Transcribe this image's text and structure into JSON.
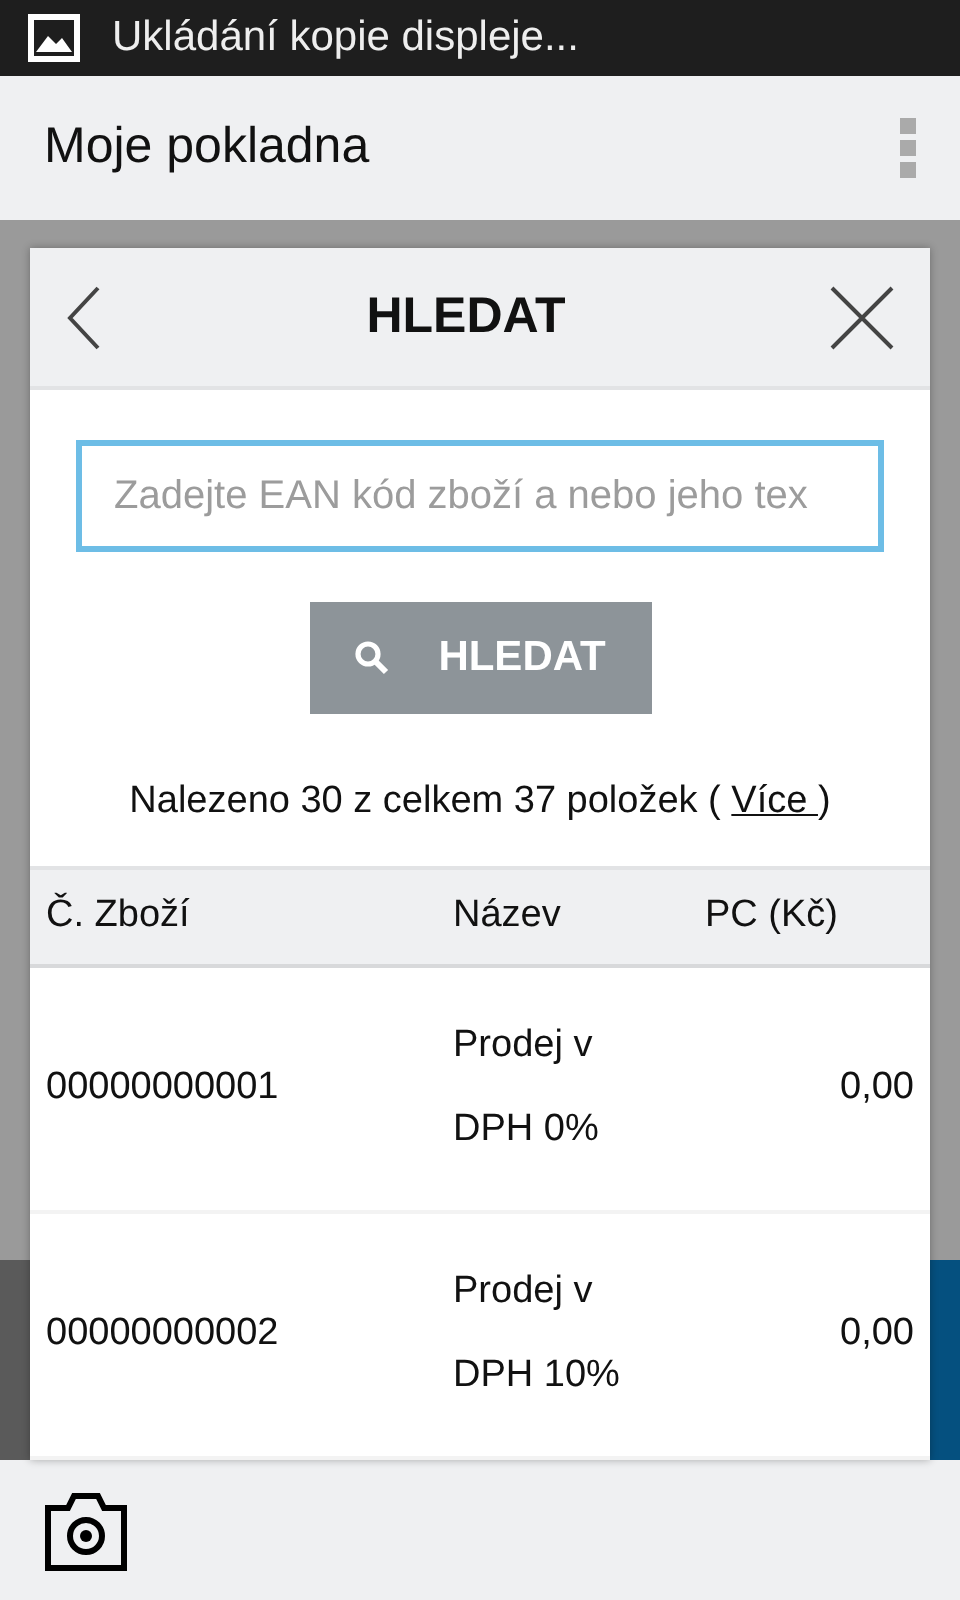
{
  "status_bar": {
    "notification": "Ukládání kopie displeje..."
  },
  "app_bar": {
    "title": "Moje pokladna"
  },
  "dialog": {
    "title": "HLEDAT",
    "search": {
      "placeholder": "Zadejte EAN kód zboží a nebo jeho tex"
    },
    "search_button": "HLEDAT",
    "result": {
      "text": "Nalezeno 30 z celkem 37 položek ( ",
      "link": "Více ",
      "end": ")"
    },
    "table": {
      "columns": [
        "Č. Zboží",
        "Název",
        "PC (Kč)"
      ],
      "rows": [
        {
          "code": "00000000001",
          "name": [
            "Prodej v",
            "DPH 0%"
          ],
          "price": "0,00"
        },
        {
          "code": "00000000002",
          "name": [
            "Prodej v",
            "DPH 10%"
          ],
          "price": "0,00"
        }
      ]
    }
  }
}
